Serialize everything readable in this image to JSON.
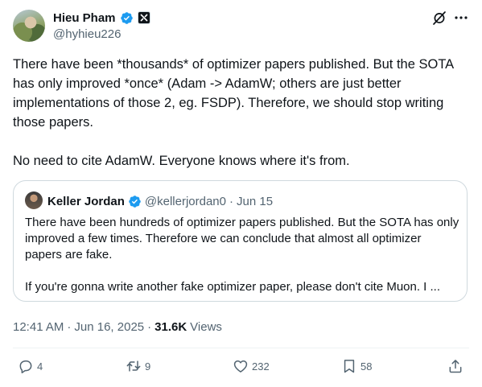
{
  "author": {
    "display_name": "Hieu Pham",
    "handle": "@hyhieu226"
  },
  "tweet": {
    "paragraph_1": "There have been *thousands* of optimizer papers published. But the SOTA has only improved *once* (Adam -> AdamW; others are just better implementations of those 2, eg. FSDP). Therefore, we should stop writing those papers.",
    "paragraph_2": "No need to cite AdamW. Everyone knows where it's from."
  },
  "quote": {
    "display_name": "Keller Jordan",
    "handle": "@kellerjordan0",
    "separator": "·",
    "date": "Jun 15",
    "paragraph_1": "There have been hundreds of optimizer papers published. But the SOTA has only improved a few times. Therefore we can conclude that almost all optimizer papers are fake.",
    "paragraph_2": "If you're gonna write another fake optimizer paper, please don't cite Muon. I ..."
  },
  "meta": {
    "time": "12:41 AM",
    "separator": "·",
    "date": "Jun 16, 2025",
    "separator_2": "·",
    "views_count": "31.6K",
    "views_label": "Views"
  },
  "actions": {
    "replies": "4",
    "reposts": "9",
    "likes": "232",
    "bookmarks": "58"
  },
  "colors": {
    "text_primary": "#0f1419",
    "text_secondary": "#536471",
    "verified_blue": "#1d9bf0",
    "border": "#cfd9de"
  },
  "icons": {
    "verified": "verified-badge-icon",
    "affiliation": "x-ai-affiliation-icon",
    "grok": "grok-icon",
    "more": "more-icon",
    "reply": "reply-icon",
    "repost": "repost-icon",
    "like": "heart-icon",
    "bookmark": "bookmark-icon",
    "share": "share-icon"
  }
}
